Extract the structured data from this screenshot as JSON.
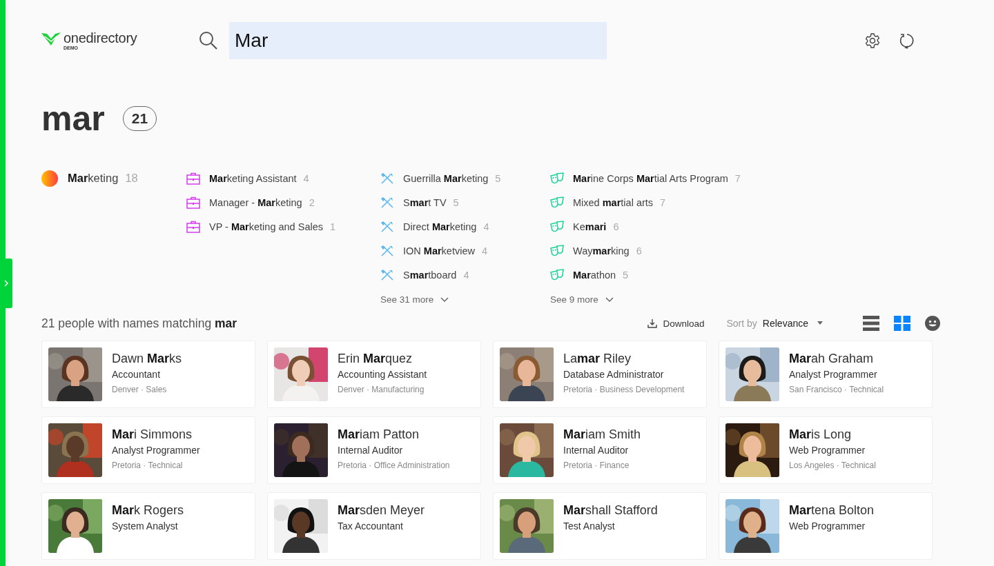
{
  "app": {
    "logo": "onedirectory",
    "logo_badge": "DEMO"
  },
  "search": {
    "value": "Mar"
  },
  "query": {
    "title": "mar",
    "count": "21"
  },
  "facets": [
    {
      "kind": "department",
      "items": [
        {
          "label": "**Mar**keting",
          "count": "18"
        }
      ]
    },
    {
      "kind": "title",
      "items": [
        {
          "label": "**Mar**keting Assistant",
          "count": "4"
        },
        {
          "label": "Manager - **Mar**keting",
          "count": "2"
        },
        {
          "label": "VP - **Mar**keting and Sales",
          "count": "1"
        }
      ]
    },
    {
      "kind": "skill",
      "items": [
        {
          "label": "Guerrilla **Mar**keting",
          "count": "5"
        },
        {
          "label": "S**mar**t TV",
          "count": "5"
        },
        {
          "label": "Direct **Mar**keting",
          "count": "4"
        },
        {
          "label": "ION **Mar**ketview",
          "count": "4"
        },
        {
          "label": "S**mar**tboard",
          "count": "4"
        }
      ],
      "more": "See 31 more"
    },
    {
      "kind": "interest",
      "items": [
        {
          "label": "**Mar**ine Corps **Mar**tial Arts Program",
          "count": "7"
        },
        {
          "label": "Mixed **mar**tial arts",
          "count": "7"
        },
        {
          "label": "Ke**mari**",
          "count": "6"
        },
        {
          "label": "Way**mar**king",
          "count": "6"
        },
        {
          "label": "**Mar**athon",
          "count": "5"
        }
      ],
      "more": "See 9 more"
    }
  ],
  "results": {
    "summary": "21 people with names matching **mar**",
    "download": "Download",
    "sort_label": "Sort by",
    "sort_value": "Relevance",
    "views": [
      {
        "kind": "list",
        "selected": false
      },
      {
        "kind": "grid",
        "selected": true
      },
      {
        "kind": "faces",
        "selected": false
      }
    ]
  },
  "people": [
    {
      "name": "Dawn **Mar**ks",
      "title": "Accountant",
      "meta": "Denver · Sales"
    },
    {
      "name": "Erin **Mar**quez",
      "title": "Accounting Assistant",
      "meta": "Denver · Manufacturing"
    },
    {
      "name": "La**mar** Riley",
      "title": "Database Administrator",
      "meta": "Pretoria · Business Development"
    },
    {
      "name": "**Mar**ah Graham",
      "title": "Analyst Programmer",
      "meta": "San Francisco · Technical"
    },
    {
      "name": "**Mar**i Simmons",
      "title": "Analyst Programmer",
      "meta": "Pretoria · Technical"
    },
    {
      "name": "**Mar**iam Patton",
      "title": "Internal Auditor",
      "meta": "Pretoria · Office Administration"
    },
    {
      "name": "**Mar**iam Smith",
      "title": "Internal Auditor",
      "meta": "Pretoria · Finance"
    },
    {
      "name": "**Mar**is Long",
      "title": "Web Programmer",
      "meta": "Los Angeles · Technical"
    },
    {
      "name": "**Mar**k Rogers",
      "title": "System Analyst"
    },
    {
      "name": "**Mar**sden Meyer",
      "title": "Tax Accountant"
    },
    {
      "name": "**Mar**shall Stafford",
      "title": "Test Analyst"
    },
    {
      "name": "**Mar**tena Bolton",
      "title": "Web Programmer"
    }
  ]
}
